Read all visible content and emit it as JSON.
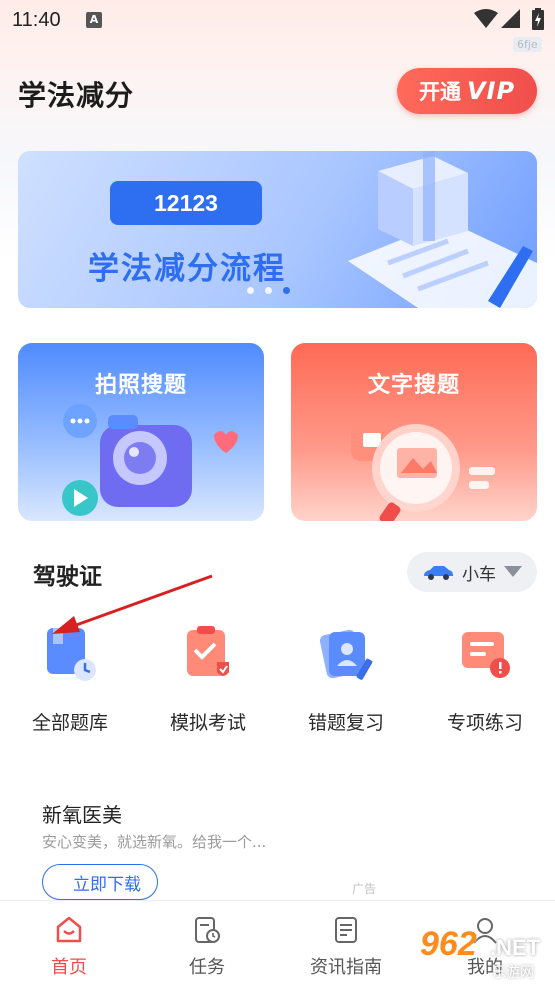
{
  "status_bar": {
    "time": "11:40",
    "notif_letter": "A"
  },
  "watermark_tag": "6fje",
  "header": {
    "title": "学法减分",
    "vip_prefix": "开通",
    "vip_label": "VIP"
  },
  "banner": {
    "number": "12123",
    "title": "学法减分流程",
    "active_dot_index": 2,
    "dot_count": 3
  },
  "features": [
    {
      "label": "拍照搜题"
    },
    {
      "label": "文字搜题"
    }
  ],
  "license": {
    "title": "驾驶证",
    "vehicle": "小车",
    "items": [
      {
        "label": "全部题库"
      },
      {
        "label": "模拟考试"
      },
      {
        "label": "错题复习"
      },
      {
        "label": "专项练习"
      }
    ]
  },
  "ad": {
    "title": "新氧医美",
    "desc": "安心变美，就选新氧。给我一个...",
    "button": "立即下载",
    "tag": "广告"
  },
  "bottom_nav": [
    {
      "label": "首页",
      "active": true
    },
    {
      "label": "任务",
      "active": false
    },
    {
      "label": "资讯指南",
      "active": false
    },
    {
      "label": "我的",
      "active": false
    }
  ],
  "site_watermark": {
    "brand": "962",
    "tld": ".NET",
    "sub": "乐游网"
  },
  "colors": {
    "accent_blue": "#2e6ff2",
    "accent_red": "#f04e4b"
  }
}
